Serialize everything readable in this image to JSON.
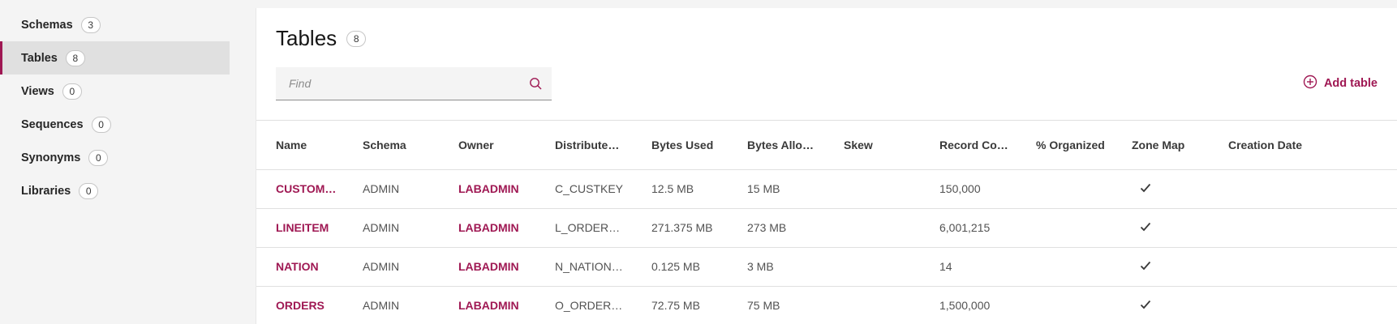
{
  "sidebar": {
    "items": [
      {
        "label": "Schemas",
        "count": "3"
      },
      {
        "label": "Tables",
        "count": "8"
      },
      {
        "label": "Views",
        "count": "0"
      },
      {
        "label": "Sequences",
        "count": "0"
      },
      {
        "label": "Synonyms",
        "count": "0"
      },
      {
        "label": "Libraries",
        "count": "0"
      }
    ],
    "active_index": 1
  },
  "header": {
    "title": "Tables",
    "count": "8"
  },
  "search": {
    "placeholder": "Find",
    "value": ""
  },
  "toolbar": {
    "add_label": "Add table"
  },
  "colors": {
    "accent": "#9f1853"
  },
  "icons": {
    "search": "search-icon",
    "add": "add-circle-icon",
    "check": "checkmark-icon"
  },
  "table": {
    "columns": [
      "Name",
      "Schema",
      "Owner",
      "Distributed ...",
      "Bytes Used",
      "Bytes Alloca...",
      "Skew",
      "Record Count",
      "% Organized",
      "Zone Map",
      "Creation Date"
    ],
    "rows": [
      {
        "name": "CUSTOMER",
        "schema": "ADMIN",
        "owner": "LABADMIN",
        "distributed": "C_CUSTKEY",
        "bytes_used": "12.5 MB",
        "bytes_allocated": "15 MB",
        "skew": "",
        "record_count": "150,000",
        "organized": "",
        "zone_map": true,
        "creation_date": ""
      },
      {
        "name": "LINEITEM",
        "schema": "ADMIN",
        "owner": "LABADMIN",
        "distributed": "L_ORDERKEY",
        "bytes_used": "271.375 MB",
        "bytes_allocated": "273 MB",
        "skew": "",
        "record_count": "6,001,215",
        "organized": "",
        "zone_map": true,
        "creation_date": ""
      },
      {
        "name": "NATION",
        "schema": "ADMIN",
        "owner": "LABADMIN",
        "distributed": "N_NATIONKEY",
        "bytes_used": "0.125 MB",
        "bytes_allocated": "3 MB",
        "skew": "",
        "record_count": "14",
        "organized": "",
        "zone_map": true,
        "creation_date": ""
      },
      {
        "name": "ORDERS",
        "schema": "ADMIN",
        "owner": "LABADMIN",
        "distributed": "O_ORDERKEY",
        "bytes_used": "72.75 MB",
        "bytes_allocated": "75 MB",
        "skew": "",
        "record_count": "1,500,000",
        "organized": "",
        "zone_map": true,
        "creation_date": ""
      }
    ]
  }
}
